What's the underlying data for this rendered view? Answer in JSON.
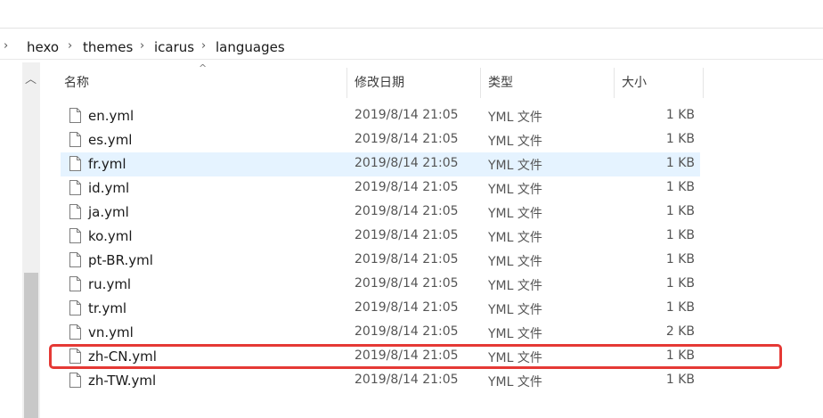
{
  "breadcrumb": [
    "hexo",
    "themes",
    "icarus",
    "languages"
  ],
  "columns": {
    "name": "名称",
    "date": "修改日期",
    "type": "类型",
    "size": "大小"
  },
  "files": [
    {
      "name": "en.yml",
      "date": "2019/8/14 21:05",
      "type": "YML 文件",
      "size": "1 KB"
    },
    {
      "name": "es.yml",
      "date": "2019/8/14 21:05",
      "type": "YML 文件",
      "size": "1 KB"
    },
    {
      "name": "fr.yml",
      "date": "2019/8/14 21:05",
      "type": "YML 文件",
      "size": "1 KB"
    },
    {
      "name": "id.yml",
      "date": "2019/8/14 21:05",
      "type": "YML 文件",
      "size": "1 KB"
    },
    {
      "name": "ja.yml",
      "date": "2019/8/14 21:05",
      "type": "YML 文件",
      "size": "1 KB"
    },
    {
      "name": "ko.yml",
      "date": "2019/8/14 21:05",
      "type": "YML 文件",
      "size": "1 KB"
    },
    {
      "name": "pt-BR.yml",
      "date": "2019/8/14 21:05",
      "type": "YML 文件",
      "size": "1 KB"
    },
    {
      "name": "ru.yml",
      "date": "2019/8/14 21:05",
      "type": "YML 文件",
      "size": "1 KB"
    },
    {
      "name": "tr.yml",
      "date": "2019/8/14 21:05",
      "type": "YML 文件",
      "size": "1 KB"
    },
    {
      "name": "vn.yml",
      "date": "2019/8/14 21:05",
      "type": "YML 文件",
      "size": "2 KB"
    },
    {
      "name": "zh-CN.yml",
      "date": "2019/8/14 21:05",
      "type": "YML 文件",
      "size": "1 KB"
    },
    {
      "name": "zh-TW.yml",
      "date": "2019/8/14 21:05",
      "type": "YML 文件",
      "size": "1 KB"
    }
  ],
  "colors": {
    "hover_row": "#e5f3ff",
    "highlight_box": "#e53935"
  },
  "icons": {
    "file": "file-icon",
    "breadcrumb_separator": "chevron-right-icon",
    "sort": "sort-ascending-icon",
    "scroll_up": "chevron-up-icon"
  }
}
